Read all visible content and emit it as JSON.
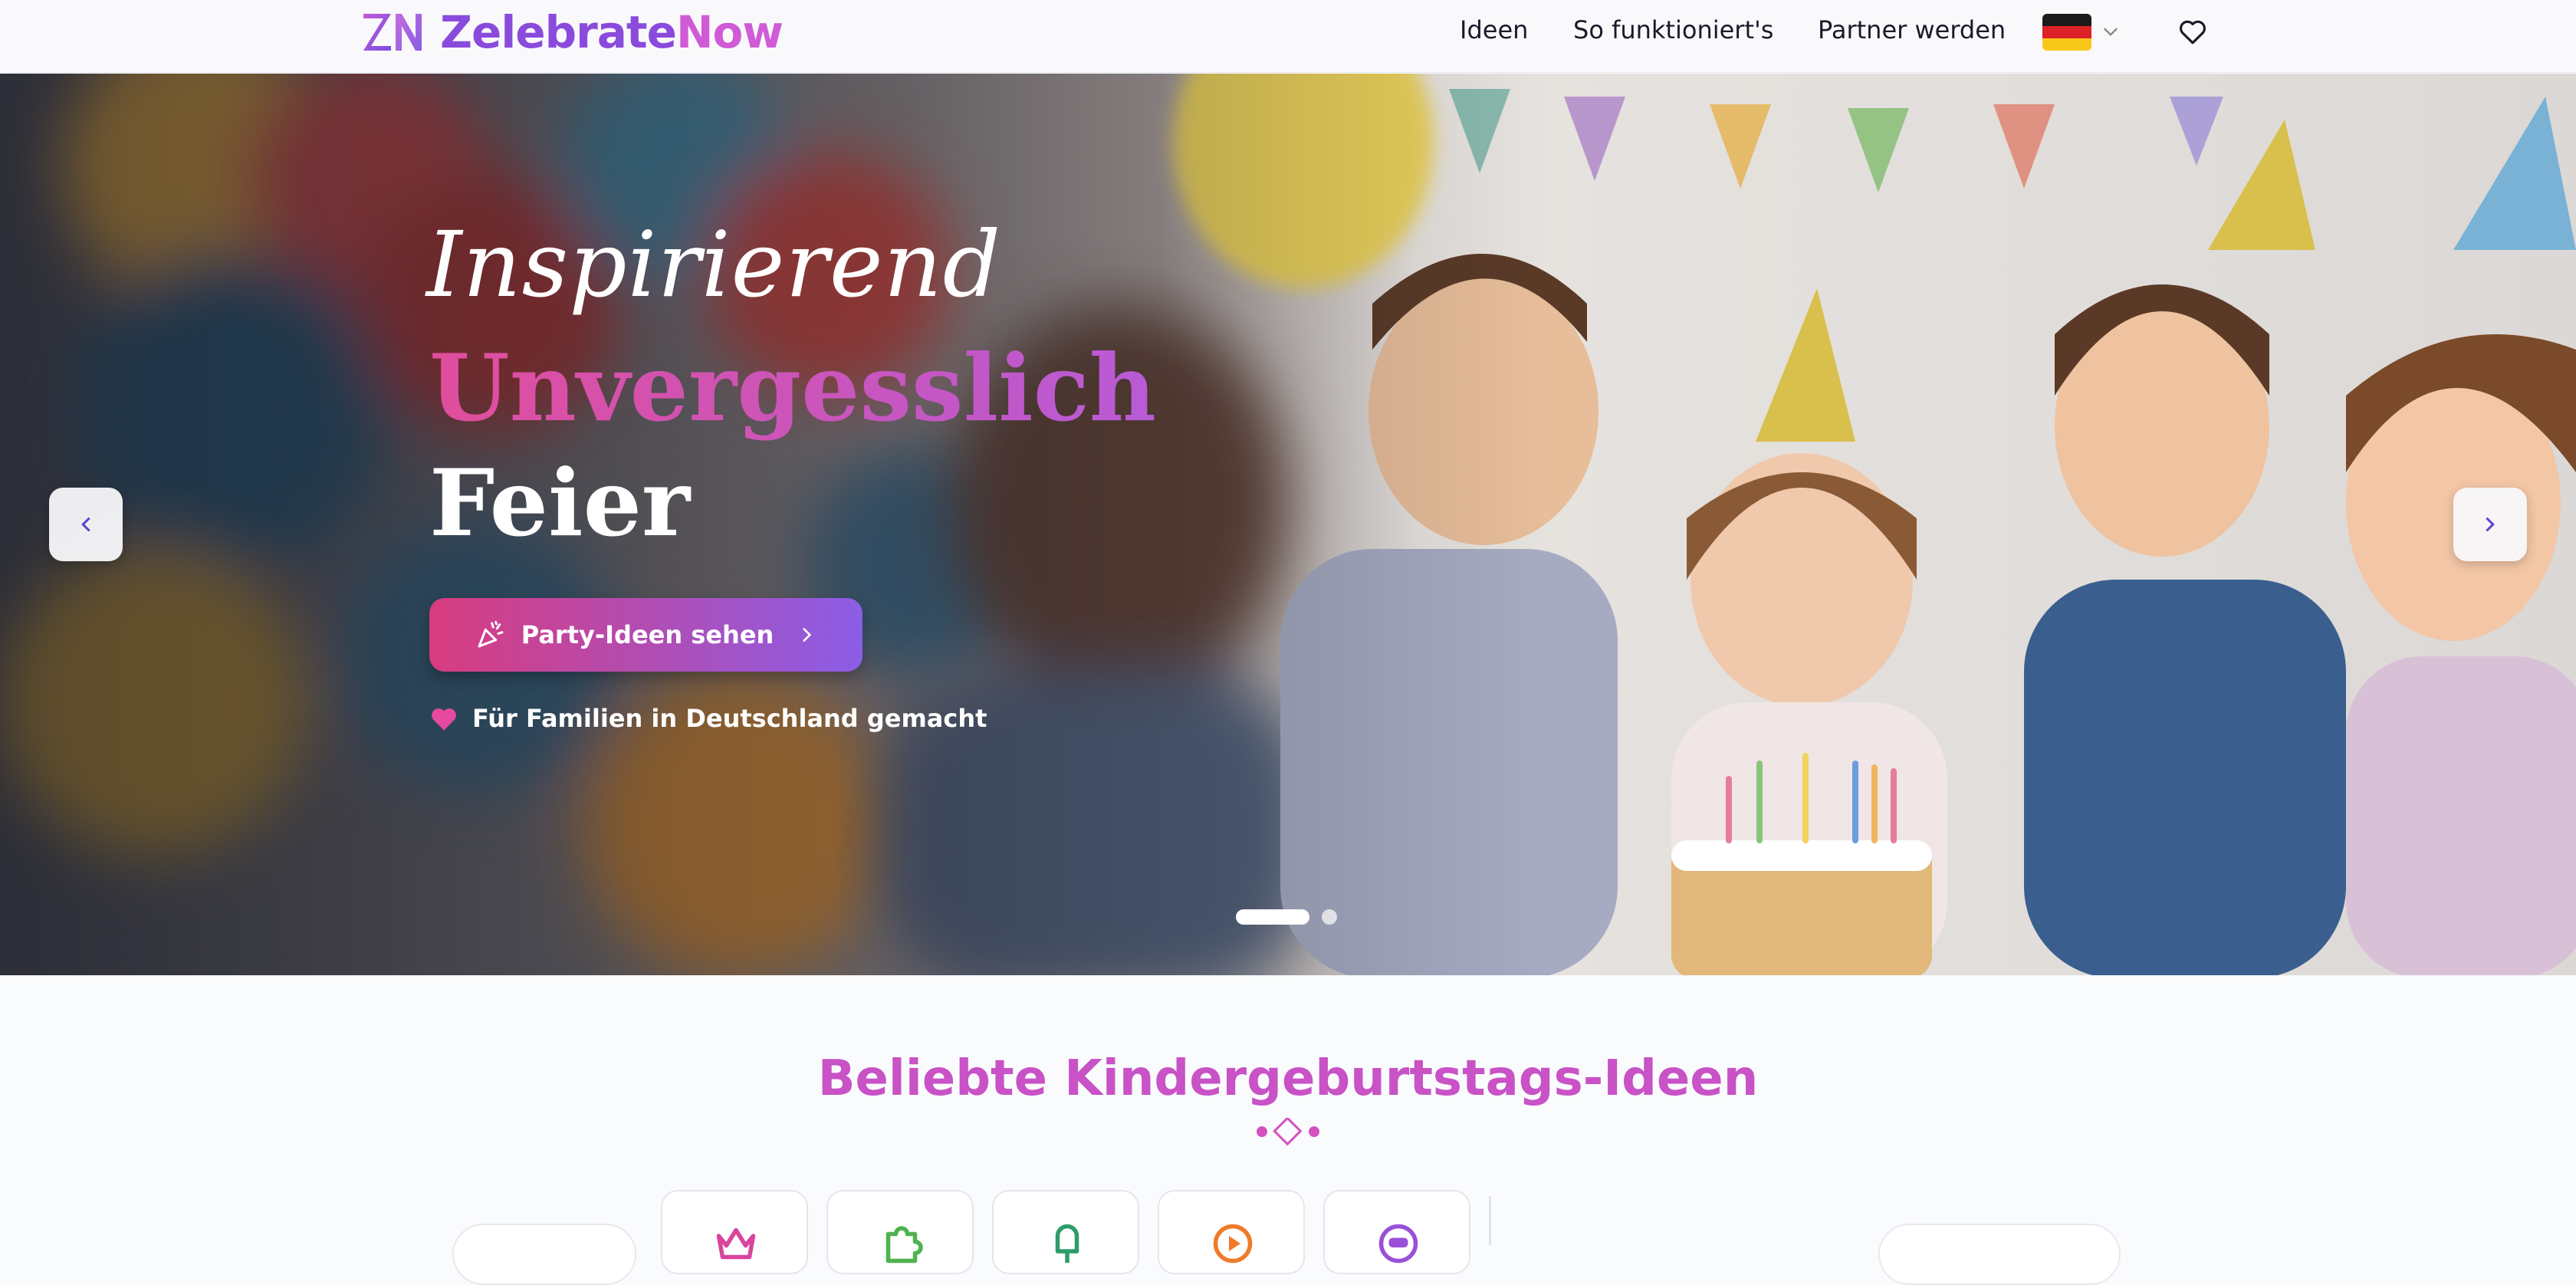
{
  "header": {
    "brand_first": "Zelebrate",
    "brand_second": "Now",
    "nav": [
      {
        "label": "Ideen"
      },
      {
        "label": "So funktioniert's"
      },
      {
        "label": "Partner werden"
      }
    ],
    "language_flag": "germany-flag-icon",
    "favorites_icon": "heart-icon"
  },
  "hero": {
    "script_line": "Inspirierend",
    "gradient_line": "Unvergesslich",
    "white_line": "Feier",
    "cta_label": "Party-Ideen sehen",
    "made_in": "Für Familien in Deutschland gemacht",
    "slides_total": 2,
    "active_slide": 1
  },
  "section": {
    "title": "Beliebte Kindergeburtstags-Ideen"
  },
  "colors": {
    "brand_purple": "#8a4bdc",
    "brand_pink": "#d05bd6",
    "cta_start": "#d83c7e",
    "cta_end": "#8b5de6",
    "section_title": "#c852c6"
  },
  "categories": [
    {
      "icon": "crown-icon",
      "color": "#d8449e"
    },
    {
      "icon": "puzzle-icon",
      "color": "#4fb24f"
    },
    {
      "icon": "popsicle-icon",
      "color": "#2e9c6a"
    },
    {
      "icon": "play-icon",
      "color": "#f07a2a"
    },
    {
      "icon": "smiley-icon",
      "color": "#9a4fd8"
    }
  ]
}
